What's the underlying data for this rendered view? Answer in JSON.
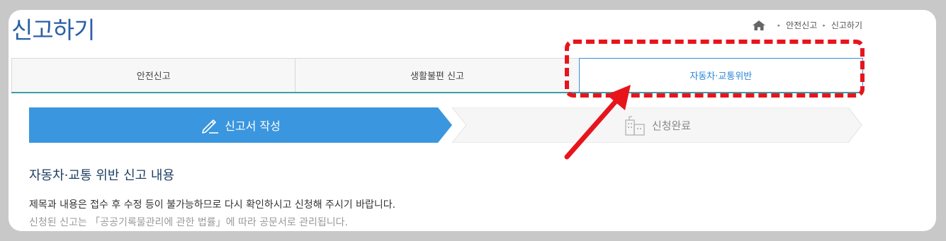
{
  "page": {
    "title": "신고하기"
  },
  "breadcrumb": {
    "items": [
      "안전신고",
      "신고하기"
    ]
  },
  "tabs": [
    {
      "label": "안전신고",
      "active": false
    },
    {
      "label": "생활불편 신고",
      "active": false
    },
    {
      "label": "자동차·교통위반",
      "active": true
    }
  ],
  "steps": [
    {
      "label": "신고서 작성",
      "icon": "pencil-icon",
      "active": true
    },
    {
      "label": "신청완료",
      "icon": "building-icon",
      "active": false
    }
  ],
  "content": {
    "section_title": "자동차·교통 위반 신고 내용",
    "line1": "제목과 내용은 접수 후 수정 등이 불가능하므로 다시 확인하시고 신청해 주시기 바랍니다.",
    "line2": "신청된 신고는 「공공기록물관리에 관한 법률」에 따라 공문서로 관리됩니다."
  },
  "colors": {
    "accent": "#3a96de",
    "title": "#2b5fa6",
    "annotation": "#e8141c"
  }
}
